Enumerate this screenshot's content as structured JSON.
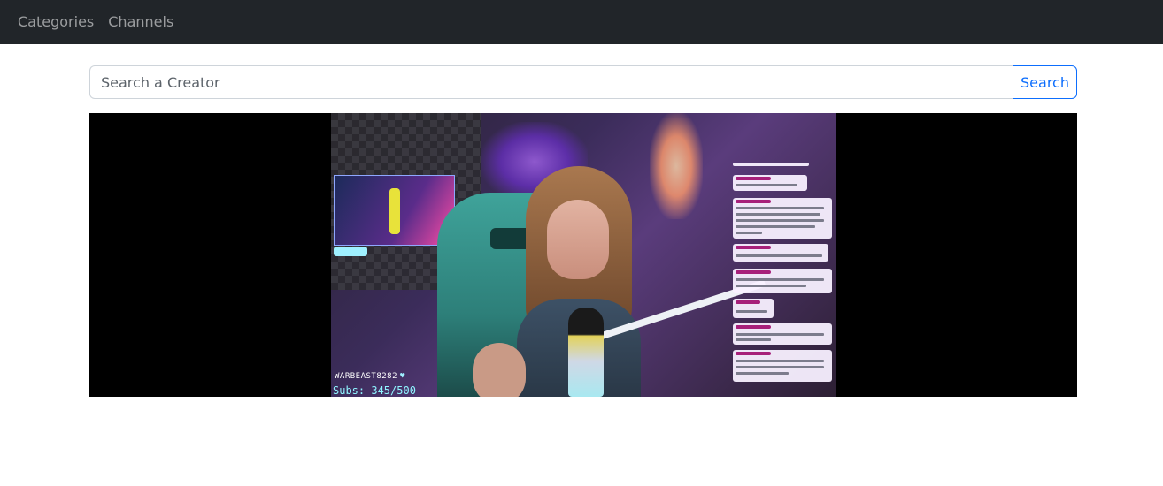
{
  "navbar": {
    "items": [
      {
        "label": "Categories"
      },
      {
        "label": "Channels"
      }
    ]
  },
  "search": {
    "placeholder": "Search a Creator",
    "value": "",
    "button_label": "Search"
  },
  "player": {
    "stream_overlay": {
      "username": "WARBEAST8282",
      "heart_icon": "heart-icon",
      "subs_text": "Subs: 345/500"
    }
  },
  "colors": {
    "navbar_bg": "#212529",
    "nav_link": "rgba(255,255,255,0.55)",
    "accent": "#0d6efd",
    "player_bg": "#000000"
  }
}
